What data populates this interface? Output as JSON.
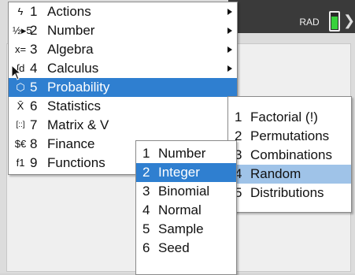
{
  "status": {
    "mode": "RAD",
    "scroll_arrow": "❯"
  },
  "main_menu": {
    "items": [
      {
        "icon": "ϟ",
        "num": "1",
        "label": "Actions",
        "has_sub": true
      },
      {
        "icon": "½▸5",
        "num": "2",
        "label": "Number",
        "has_sub": true
      },
      {
        "icon": "x=",
        "num": "3",
        "label": "Algebra",
        "has_sub": true
      },
      {
        "icon": "∫d",
        "num": "4",
        "label": "Calculus",
        "has_sub": true
      },
      {
        "icon": "⬡",
        "num": "5",
        "label": "Probability",
        "has_sub": true
      },
      {
        "icon": "X̄",
        "num": "6",
        "label": "Statistics",
        "has_sub": false
      },
      {
        "icon": "[::]",
        "num": "7",
        "label": "Matrix & V",
        "has_sub": false
      },
      {
        "icon": "$€",
        "num": "8",
        "label": "Finance",
        "has_sub": false
      },
      {
        "icon": "f1",
        "num": "9",
        "label": "Functions",
        "has_sub": false
      }
    ],
    "selected_index": 4
  },
  "probability_menu": {
    "items": [
      {
        "num": "1",
        "label": "Factorial (!)"
      },
      {
        "num": "2",
        "label": "Permutations"
      },
      {
        "num": "3",
        "label": "Combinations"
      },
      {
        "num": "4",
        "label": "Random"
      },
      {
        "num": "5",
        "label": "Distributions"
      }
    ],
    "highlight_index": 3
  },
  "random_menu": {
    "items": [
      {
        "num": "1",
        "label": "Number"
      },
      {
        "num": "2",
        "label": "Integer"
      },
      {
        "num": "3",
        "label": "Binomial"
      },
      {
        "num": "4",
        "label": "Normal"
      },
      {
        "num": "5",
        "label": "Sample"
      },
      {
        "num": "6",
        "label": "Seed"
      }
    ],
    "selected_index": 1
  },
  "colors": {
    "selected": "#2f7fd0",
    "highlight": "#9fc3e8",
    "battery": "#37d13b"
  }
}
